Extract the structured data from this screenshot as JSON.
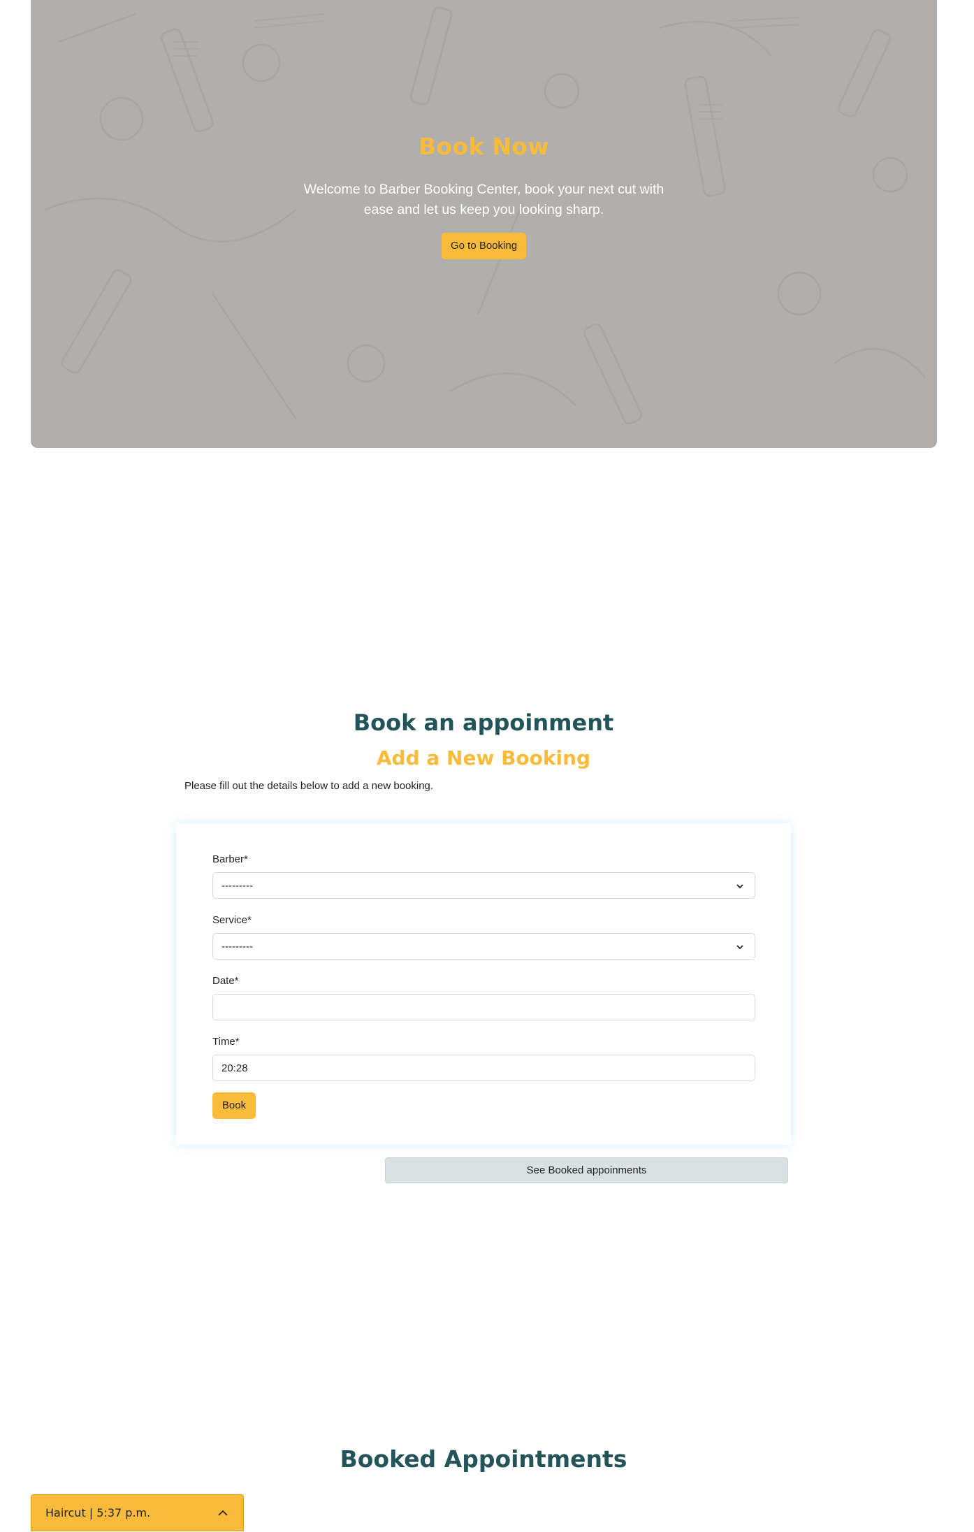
{
  "hero": {
    "title": "Book Now",
    "text": "Welcome to Barber Booking Center, book your next cut with ease and let us keep you looking sharp.",
    "button_label": "Go to Booking"
  },
  "booking": {
    "title": "Book an appoinment",
    "subtitle": "Add a New Booking",
    "description": "Please fill out the details below to add a new booking.",
    "fields": {
      "barber": {
        "label": "Barber*",
        "value": "---------"
      },
      "service": {
        "label": "Service*",
        "value": "---------"
      },
      "date": {
        "label": "Date*",
        "value": ""
      },
      "time": {
        "label": "Time*",
        "value": "20:28"
      }
    },
    "book_label": "Book",
    "see_booked_label": "See Booked appoinments"
  },
  "booked": {
    "title": "Booked Appointments"
  },
  "toast": {
    "text": "Haircut | 5:37 p.m."
  },
  "colors": {
    "accent": "#fbbb3a",
    "heading": "#22545a",
    "hero_bg": "#b0afad"
  },
  "icons": [
    "chevron-down-icon",
    "chevron-up-icon"
  ]
}
